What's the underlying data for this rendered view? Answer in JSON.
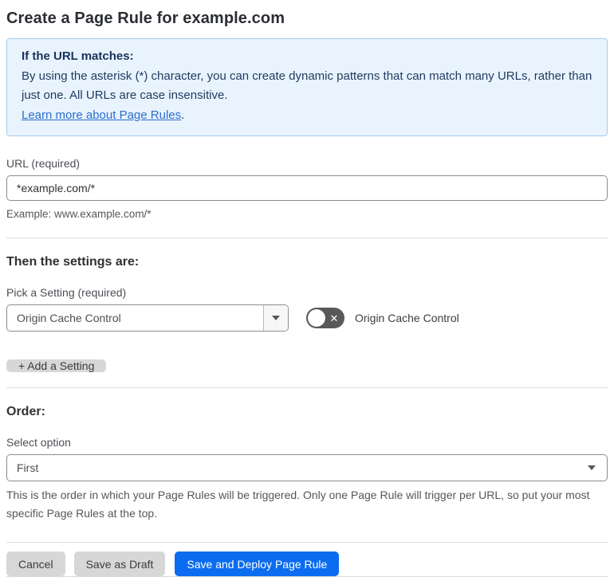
{
  "page": {
    "title": "Create a Page Rule for example.com"
  },
  "colors": {
    "primary_button_blue": "#0b6cf0",
    "info_box_bg": "#e9f3fd",
    "info_box_border": "#a5ccee",
    "info_text_navy": "#1e3a5f",
    "link_blue": "#2a6fce",
    "toggle_off_gray": "#595959",
    "gray_button_bg": "#d7d7d7"
  },
  "info_box": {
    "heading": "If the URL matches:",
    "body": "By using the asterisk (*) character, you can create dynamic patterns that can match many URLs, rather than just one. All URLs are case insensitive.",
    "link_label": "Learn more about Page Rules",
    "link_suffix": "."
  },
  "url_section": {
    "label": "URL (required)",
    "value": "*example.com/*",
    "example": "Example: www.example.com/*"
  },
  "settings_section": {
    "heading": "Then the settings are:",
    "pick_label": "Pick a Setting (required)",
    "selected_setting": "Origin Cache Control",
    "toggle_state": "off",
    "toggle_glyph": "✕",
    "toggle_label": "Origin Cache Control",
    "add_button_label": "+ Add a Setting"
  },
  "order_section": {
    "heading": "Order:",
    "label": "Select option",
    "selected_option": "First",
    "help": "This is the order in which your Page Rules will be triggered. Only one Page Rule will trigger per URL, so put your most specific Page Rules at the top."
  },
  "footer": {
    "cancel_label": "Cancel",
    "save_draft_label": "Save as Draft",
    "save_deploy_label": "Save and Deploy Page Rule"
  }
}
